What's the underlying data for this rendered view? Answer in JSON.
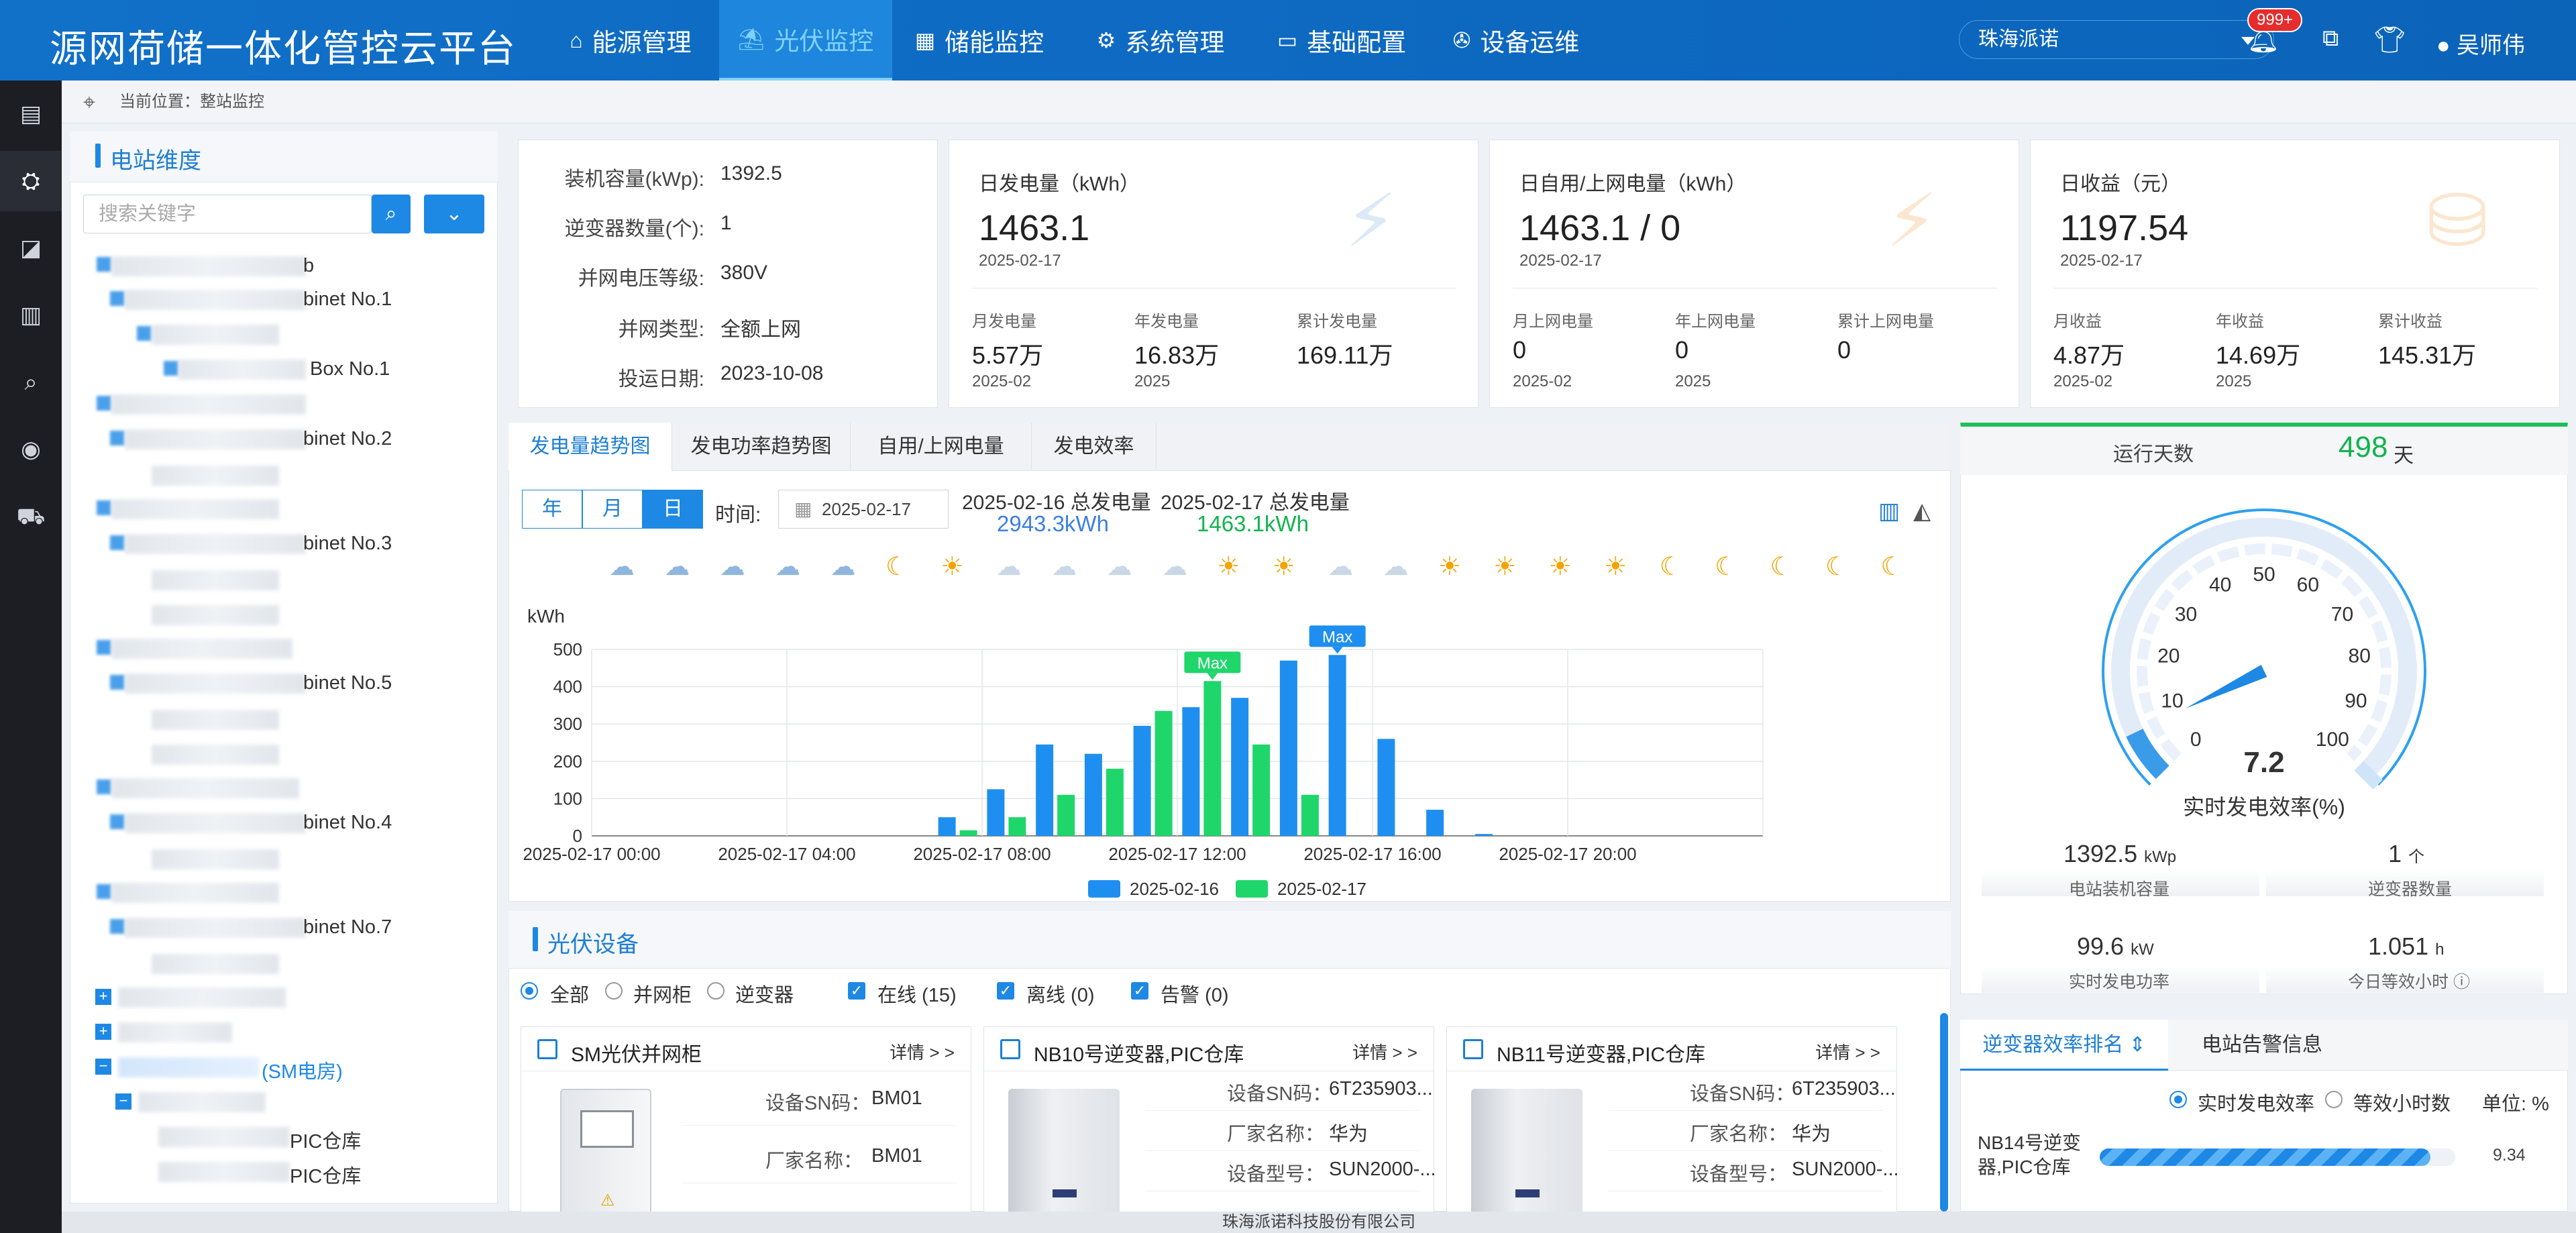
{
  "app": {
    "title": "源网荷储一体化管控云平台"
  },
  "nav": [
    {
      "label": "能源管理",
      "icon": "home-icon"
    },
    {
      "label": "光伏监控",
      "icon": "solar-panel-icon",
      "active": true
    },
    {
      "label": "储能监控",
      "icon": "battery-icon"
    },
    {
      "label": "系统管理",
      "icon": "gear-icon"
    },
    {
      "label": "基础配置",
      "icon": "monitor-icon"
    },
    {
      "label": "设备运维",
      "icon": "wrench-icon"
    }
  ],
  "header": {
    "station_select": "珠海派诺",
    "notification_count": "999+",
    "user": "吴师伟"
  },
  "breadcrumb": "当前位置：整站监控",
  "left_panel": {
    "title": "电站维度",
    "search_placeholder": "搜索关键字",
    "tree": [
      "b",
      "binet No.1",
      "Box No.1",
      "binet No.2",
      "binet No.3",
      "binet No.5",
      "binet No.4",
      "binet No.7",
      "(SM电房)",
      "PIC仓库",
      "PIC仓库"
    ]
  },
  "station_info": [
    {
      "label": "装机容量(kWp):",
      "value": "1392.5"
    },
    {
      "label": "逆变器数量(个):",
      "value": "1"
    },
    {
      "label": "并网电压等级:",
      "value": "380V"
    },
    {
      "label": "并网类型:",
      "value": "全额上网"
    },
    {
      "label": "投运日期:",
      "value": "2023-10-08"
    }
  ],
  "kpi_cards": [
    {
      "title": "日发电量（kWh）",
      "value": "1463.1",
      "date": "2025-02-17",
      "icon": "solar-panel-icon",
      "subs": [
        {
          "label": "月发电量",
          "value": "5.57万",
          "date": "2025-02"
        },
        {
          "label": "年发电量",
          "value": "16.83万",
          "date": "2025"
        },
        {
          "label": "累计发电量",
          "value": "169.11万",
          "date": ""
        }
      ]
    },
    {
      "title": "日自用/上网电量（kWh）",
      "value": "1463.1 / 0",
      "date": "2025-02-17",
      "icon": "solar-factory-icon",
      "subs": [
        {
          "label": "月上网电量",
          "value": "0",
          "date": "2025-02"
        },
        {
          "label": "年上网电量",
          "value": "0",
          "date": "2025"
        },
        {
          "label": "累计上网电量",
          "value": "0",
          "date": ""
        }
      ]
    },
    {
      "title": "日收益（元）",
      "value": "1197.54",
      "date": "2025-02-17",
      "icon": "coins-icon",
      "subs": [
        {
          "label": "月收益",
          "value": "4.87万",
          "date": "2025-02"
        },
        {
          "label": "年收益",
          "value": "14.69万",
          "date": "2025"
        },
        {
          "label": "累计收益",
          "value": "145.31万",
          "date": ""
        }
      ]
    }
  ],
  "chart_tabs": [
    "发电量趋势图",
    "发电功率趋势图",
    "自用/上网电量",
    "发电效率"
  ],
  "period_buttons": [
    "年",
    "月",
    "日"
  ],
  "time_label": "时间:",
  "date_value": "2025-02-17",
  "gen_summary": [
    {
      "label": "2025-02-16 总发电量",
      "value": "2943.3kWh",
      "color": "#3d7fe0"
    },
    {
      "label": "2025-02-17 总发电量",
      "value": "1463.1kWh",
      "color": "#13b34f"
    }
  ],
  "weather": [
    "cloud",
    "cloud",
    "cloud",
    "cloud",
    "cloud",
    "moon",
    "sun",
    "pc",
    "pc",
    "pc",
    "pc",
    "sun",
    "sun",
    "pc",
    "pc",
    "sun",
    "sun",
    "sun",
    "sun",
    "moon",
    "moon",
    "moon",
    "moon",
    "moon"
  ],
  "chart_data": {
    "type": "bar",
    "ylabel": "kWh",
    "ylim": [
      0,
      500
    ],
    "yticks": [
      0,
      100,
      200,
      300,
      400,
      500
    ],
    "xtick_labels": [
      "2025-02-17 00:00",
      "2025-02-17 04:00",
      "2025-02-17 08:00",
      "2025-02-17 12:00",
      "2025-02-17 16:00",
      "2025-02-17 20:00"
    ],
    "x_hours": [
      0,
      1,
      2,
      3,
      4,
      5,
      6,
      7,
      8,
      9,
      10,
      11,
      12,
      13,
      14,
      15,
      16,
      17,
      18,
      19,
      20,
      21,
      22,
      23
    ],
    "series": [
      {
        "name": "2025-02-16",
        "color": "#1e8ff0",
        "values": [
          0,
          0,
          0,
          0,
          0,
          0,
          0,
          50,
          125,
          245,
          220,
          295,
          345,
          370,
          470,
          485,
          260,
          70,
          5,
          0,
          0,
          0,
          0,
          0
        ]
      },
      {
        "name": "2025-02-17",
        "color": "#1fd66b",
        "values": [
          0,
          0,
          0,
          0,
          0,
          0,
          0,
          15,
          50,
          110,
          180,
          335,
          415,
          245,
          110,
          0,
          0,
          0,
          0,
          0,
          0,
          0,
          0,
          0
        ]
      }
    ],
    "markers": [
      {
        "series": 1,
        "index": 12,
        "label": "Max"
      },
      {
        "series": 0,
        "index": 15,
        "label": "Max"
      }
    ],
    "legend": "bottom-center"
  },
  "devices": {
    "title": "光伏设备",
    "filters_type": [
      {
        "label": "全部",
        "on": true
      },
      {
        "label": "并网柜",
        "on": false
      },
      {
        "label": "逆变器",
        "on": false
      }
    ],
    "filters_status": [
      "在线 (15)",
      "离线 (0)",
      "告警 (0)"
    ],
    "more_label": "详情 > >",
    "cards": [
      {
        "name": "SM光伏并网柜",
        "rows": [
          {
            "k": "设备SN码：",
            "v": "BM01"
          },
          {
            "k": "厂家名称：",
            "v": "BM01"
          }
        ]
      },
      {
        "name": "NB10号逆变器,PIC仓库",
        "rows": [
          {
            "k": "设备SN码：",
            "v": "6T235903..."
          },
          {
            "k": "厂家名称：",
            "v": "华为"
          },
          {
            "k": "设备型号：",
            "v": "SUN2000-..."
          }
        ]
      },
      {
        "name": "NB11号逆变器,PIC仓库",
        "rows": [
          {
            "k": "设备SN码：",
            "v": "6T235903..."
          },
          {
            "k": "厂家名称：",
            "v": "华为"
          },
          {
            "k": "设备型号：",
            "v": "SUN2000-..."
          }
        ]
      }
    ]
  },
  "gauge": {
    "run_days_label": "运行天数",
    "run_days": "498",
    "run_days_unit": "天",
    "ticks": [
      "0",
      "10",
      "20",
      "30",
      "40",
      "50",
      "60",
      "70",
      "80",
      "90",
      "100"
    ],
    "value": 7.2,
    "value_text": "7.2",
    "label": "实时发电效率(%)",
    "max": 100
  },
  "stats": [
    {
      "value": "1392.5",
      "unit": "kWp",
      "label": "电站装机容量"
    },
    {
      "value": "1",
      "unit": "个",
      "label": "逆变器数量"
    },
    {
      "value": "99.6",
      "unit": "kW",
      "label": "实时发电功率"
    },
    {
      "value": "1.051",
      "unit": "h",
      "label": "今日等效小时"
    }
  ],
  "ranking": {
    "tabs": [
      "逆变器效率排名",
      "电站告警信息"
    ],
    "options": [
      {
        "label": "实时发电效率",
        "on": true
      },
      {
        "label": "等效小时数",
        "on": false
      }
    ],
    "unit_label": "单位:  %",
    "items": [
      {
        "name": "NB14号逆变器,PIC仓库",
        "value": "9.34",
        "fraction": 0.93
      }
    ]
  },
  "footer": "珠海派诺科技股份有限公司"
}
